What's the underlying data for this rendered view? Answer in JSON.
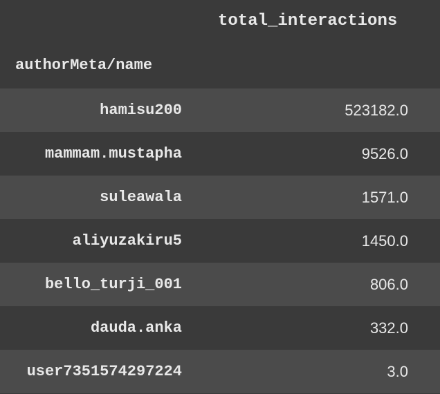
{
  "chart_data": {
    "type": "table",
    "title": "",
    "columns": [
      "authorMeta/name",
      "total_interactions"
    ],
    "index_label": "authorMeta/name",
    "value_column": "total_interactions",
    "rows": [
      {
        "name": "hamisu200",
        "value": "523182.0"
      },
      {
        "name": "mammam.mustapha",
        "value": "9526.0"
      },
      {
        "name": "suleawala",
        "value": "1571.0"
      },
      {
        "name": "aliyuzakiru5",
        "value": "1450.0"
      },
      {
        "name": "bello_turji_001",
        "value": "806.0"
      },
      {
        "name": "dauda.anka",
        "value": "332.0"
      },
      {
        "name": "user7351574297224",
        "value": "3.0"
      }
    ]
  }
}
